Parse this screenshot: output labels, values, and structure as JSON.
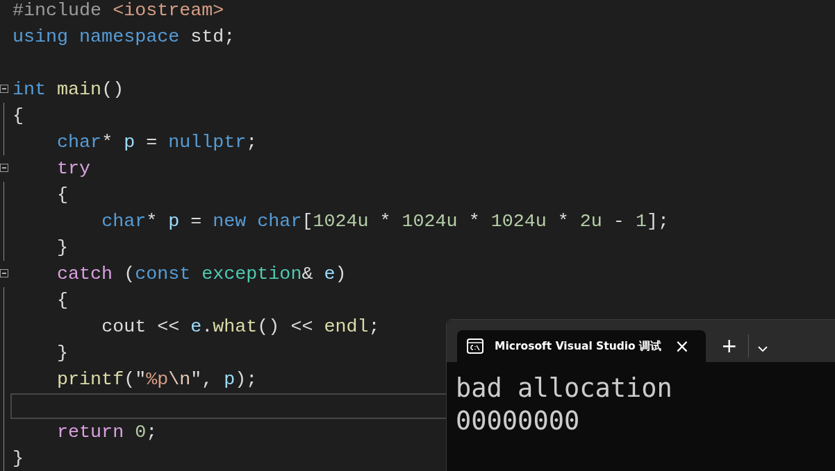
{
  "editor": {
    "lines": [
      {
        "tokens": [
          {
            "text": "#include ",
            "kind": "preprocessor"
          },
          {
            "text": "<iostream>",
            "kind": "string"
          }
        ]
      },
      {
        "tokens": [
          {
            "text": "using namespace",
            "kind": "keyword"
          },
          {
            "text": " std;",
            "kind": "plain"
          }
        ]
      },
      {
        "current": false
      },
      {
        "fold": true,
        "tokens": [
          {
            "text": "int ",
            "kind": "keyword"
          },
          {
            "text": "main",
            "kind": "function"
          },
          {
            "text": "()",
            "kind": "plain"
          }
        ]
      },
      {
        "tokens": [
          {
            "text": "{",
            "kind": "plain"
          }
        ]
      },
      {
        "tokens": [
          {
            "text": "    char",
            "kind": "keyword"
          },
          {
            "text": "* ",
            "kind": "plain"
          },
          {
            "text": "p",
            "kind": "variable"
          },
          {
            "text": " = ",
            "kind": "plain"
          },
          {
            "text": "nullptr",
            "kind": "keyword"
          },
          {
            "text": ";",
            "kind": "plain"
          }
        ]
      },
      {
        "fold": true,
        "tokens": [
          {
            "text": "    try",
            "kind": "control"
          }
        ]
      },
      {
        "tokens": [
          {
            "text": "    {",
            "kind": "plain"
          }
        ]
      },
      {
        "tokens": [
          {
            "text": "        char",
            "kind": "keyword"
          },
          {
            "text": "* ",
            "kind": "plain"
          },
          {
            "text": "p",
            "kind": "variable"
          },
          {
            "text": " = ",
            "kind": "plain"
          },
          {
            "text": "new char",
            "kind": "keyword"
          },
          {
            "text": "[",
            "kind": "plain"
          },
          {
            "text": "1024u",
            "kind": "number"
          },
          {
            "text": " * ",
            "kind": "plain"
          },
          {
            "text": "1024u",
            "kind": "number"
          },
          {
            "text": " * ",
            "kind": "plain"
          },
          {
            "text": "1024u",
            "kind": "number"
          },
          {
            "text": " * ",
            "kind": "plain"
          },
          {
            "text": "2u",
            "kind": "number"
          },
          {
            "text": " - ",
            "kind": "plain"
          },
          {
            "text": "1",
            "kind": "number"
          },
          {
            "text": "];",
            "kind": "plain"
          }
        ]
      },
      {
        "tokens": [
          {
            "text": "    }",
            "kind": "plain"
          }
        ]
      },
      {
        "fold": true,
        "tokens": [
          {
            "text": "    catch",
            "kind": "control"
          },
          {
            "text": " (",
            "kind": "plain"
          },
          {
            "text": "const ",
            "kind": "keyword"
          },
          {
            "text": "exception",
            "kind": "type"
          },
          {
            "text": "& ",
            "kind": "plain"
          },
          {
            "text": "e",
            "kind": "variable"
          },
          {
            "text": ")",
            "kind": "plain"
          }
        ]
      },
      {
        "tokens": [
          {
            "text": "    {",
            "kind": "plain"
          }
        ]
      },
      {
        "tokens": [
          {
            "text": "        cout << ",
            "kind": "plain"
          },
          {
            "text": "e",
            "kind": "variable"
          },
          {
            "text": ".",
            "kind": "plain"
          },
          {
            "text": "what",
            "kind": "function"
          },
          {
            "text": "() << ",
            "kind": "plain"
          },
          {
            "text": "endl",
            "kind": "function"
          },
          {
            "text": ";",
            "kind": "plain"
          }
        ]
      },
      {
        "tokens": [
          {
            "text": "    }",
            "kind": "plain"
          }
        ]
      },
      {
        "tokens": [
          {
            "text": "    printf",
            "kind": "function"
          },
          {
            "text": "(\"",
            "kind": "plain"
          },
          {
            "text": "%p",
            "kind": "string"
          },
          {
            "text": "\\n",
            "kind": "escape"
          },
          {
            "text": "\", ",
            "kind": "plain"
          },
          {
            "text": "p",
            "kind": "variable"
          },
          {
            "text": ");",
            "kind": "plain"
          }
        ]
      },
      {
        "current": true
      },
      {
        "tokens": [
          {
            "text": "    return",
            "kind": "control"
          },
          {
            "text": " 0",
            "kind": "number"
          },
          {
            "text": ";",
            "kind": "plain"
          }
        ]
      },
      {
        "tokens": [
          {
            "text": "}",
            "kind": "plain"
          }
        ]
      }
    ]
  },
  "terminal": {
    "tab": {
      "title": "Microsoft Visual Studio 调试",
      "close": "×",
      "selected": true
    },
    "new_tab": "+",
    "output": [
      "bad allocation",
      "00000000"
    ]
  }
}
